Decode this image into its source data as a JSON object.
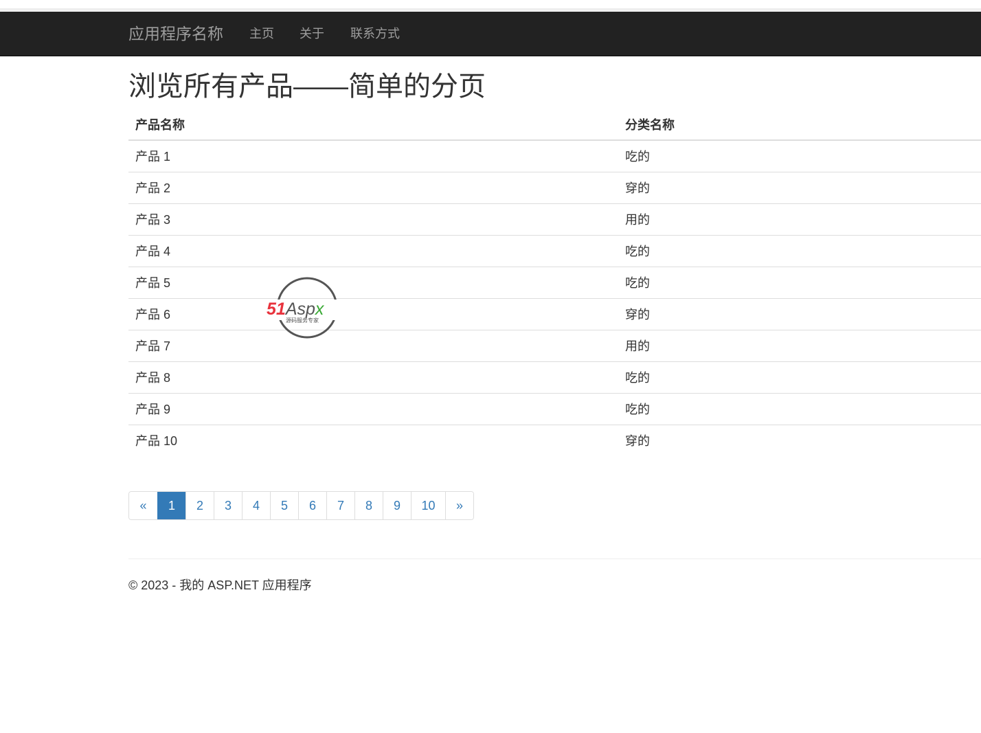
{
  "navbar": {
    "brand": "应用程序名称",
    "links": [
      "主页",
      "关于",
      "联系方式"
    ]
  },
  "page_title": "浏览所有产品——简单的分页",
  "table": {
    "headers": [
      "产品名称",
      "分类名称"
    ],
    "rows": [
      [
        "产品 1",
        "吃的"
      ],
      [
        "产品 2",
        "穿的"
      ],
      [
        "产品 3",
        "用的"
      ],
      [
        "产品 4",
        "吃的"
      ],
      [
        "产品 5",
        "吃的"
      ],
      [
        "产品 6",
        "穿的"
      ],
      [
        "产品 7",
        "用的"
      ],
      [
        "产品 8",
        "吃的"
      ],
      [
        "产品 9",
        "吃的"
      ],
      [
        "产品 10",
        "穿的"
      ]
    ]
  },
  "pagination": {
    "prev": "«",
    "next": "»",
    "pages": [
      "1",
      "2",
      "3",
      "4",
      "5",
      "6",
      "7",
      "8",
      "9",
      "10"
    ],
    "current_page": "1"
  },
  "footer": "© 2023 - 我的 ASP.NET 应用程序",
  "watermark": {
    "logo_text": "51Aspx",
    "tagline": "源码服务专家"
  },
  "colors": {
    "navbar_bg": "#222222",
    "nav_text": "#9d9d9d",
    "link": "#337ab7",
    "active_page_bg": "#337ab7"
  }
}
